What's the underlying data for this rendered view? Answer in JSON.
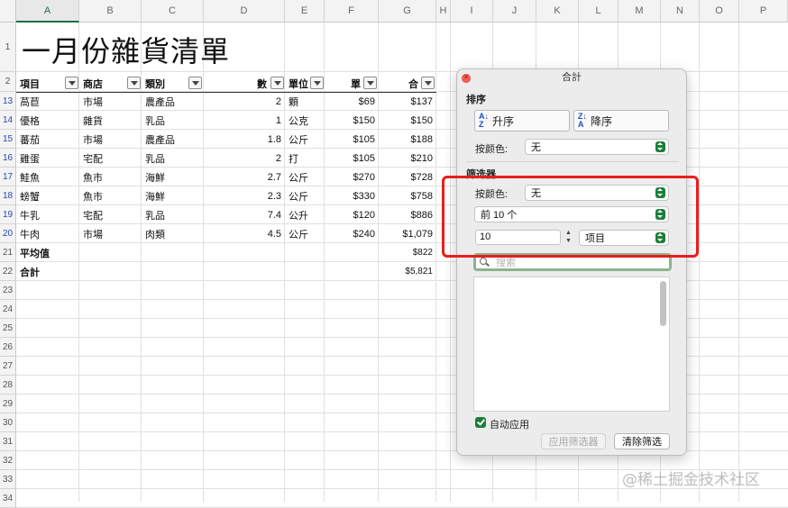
{
  "columns": [
    "A",
    "B",
    "C",
    "D",
    "E",
    "F",
    "G",
    "H",
    "I",
    "J",
    "K",
    "L",
    "M",
    "N",
    "O",
    "P"
  ],
  "rows": [
    "1",
    "2",
    "13",
    "14",
    "15",
    "16",
    "17",
    "18",
    "19",
    "20",
    "21",
    "22",
    "23",
    "24",
    "25",
    "26",
    "27",
    "28",
    "29",
    "30",
    "31",
    "32",
    "33",
    "34"
  ],
  "sheet_title": "一月份雜貨清單",
  "headers": {
    "a": "項目",
    "b": "商店",
    "c": "類別",
    "d": "數",
    "e": "單位",
    "f": "單",
    "g": "合"
  },
  "table": [
    {
      "item": "萵苣",
      "store": "市場",
      "cat": "農產品",
      "qty": "2",
      "unit": "顆",
      "price": "$69",
      "total": "$137"
    },
    {
      "item": "優格",
      "store": "雜貨",
      "cat": "乳品",
      "qty": "1",
      "unit": "公克",
      "price": "$150",
      "total": "$150"
    },
    {
      "item": "蕃茄",
      "store": "市場",
      "cat": "農產品",
      "qty": "1.8",
      "unit": "公斤",
      "price": "$105",
      "total": "$188"
    },
    {
      "item": "雞蛋",
      "store": "宅配",
      "cat": "乳品",
      "qty": "2",
      "unit": "打",
      "price": "$105",
      "total": "$210"
    },
    {
      "item": "鮭魚",
      "store": "魚市",
      "cat": "海鮮",
      "qty": "2.7",
      "unit": "公斤",
      "price": "$270",
      "total": "$728"
    },
    {
      "item": "螃蟹",
      "store": "魚市",
      "cat": "海鮮",
      "qty": "2.3",
      "unit": "公斤",
      "price": "$330",
      "total": "$758"
    },
    {
      "item": "牛乳",
      "store": "宅配",
      "cat": "乳品",
      "qty": "7.4",
      "unit": "公升",
      "price": "$120",
      "total": "$886"
    },
    {
      "item": "牛肉",
      "store": "市場",
      "cat": "肉類",
      "qty": "4.5",
      "unit": "公斤",
      "price": "$240",
      "total": "$1,079"
    }
  ],
  "summary": [
    {
      "label": "平均值",
      "value": "$822"
    },
    {
      "label": "合計",
      "value": "$5,821"
    }
  ],
  "panel": {
    "title": "合計",
    "sort_section": "排序",
    "sort_asc": "升序",
    "sort_desc": "降序",
    "color_label": "按颜色:",
    "sort_color_value": "无",
    "filter_section": "筛选器",
    "filter_color_value": "无",
    "top_select": "前 10 个",
    "top_count": "10",
    "top_unit": "项目",
    "search_placeholder": "搜索",
    "auto_apply": "自动应用",
    "apply_button": "应用筛选器",
    "clear_button": "清除筛选"
  },
  "watermark": "@稀土掘金技术社区"
}
